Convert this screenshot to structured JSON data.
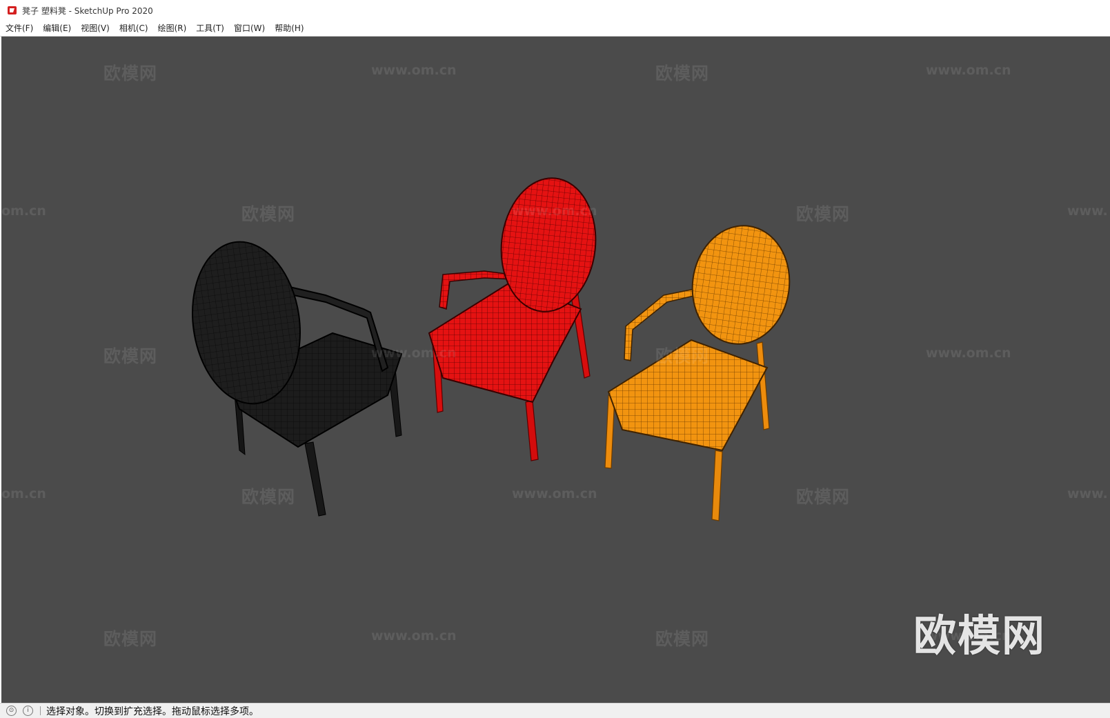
{
  "window": {
    "title": "凳子 塑料凳 - SketchUp Pro 2020",
    "app_icon": "sketchup-icon"
  },
  "menu": [
    {
      "label": "文件(F)"
    },
    {
      "label": "编辑(E)"
    },
    {
      "label": "视图(V)"
    },
    {
      "label": "相机(C)"
    },
    {
      "label": "绘图(R)"
    },
    {
      "label": "工具(T)"
    },
    {
      "label": "窗口(W)"
    },
    {
      "label": "帮助(H)"
    }
  ],
  "viewport": {
    "background": "#4b4b4b",
    "models": [
      {
        "name": "chair-black",
        "color": "#1c1c1c"
      },
      {
        "name": "chair-red",
        "color": "#e01010"
      },
      {
        "name": "chair-orange",
        "color": "#f0900e"
      }
    ],
    "watermark_brand": "欧模网",
    "watermark_url": "www.om.cn",
    "watermark_partial_url": "om.cn",
    "watermark_partial_url_right": "www.",
    "logo_text": "欧模网"
  },
  "status": {
    "icons": [
      "geo-location-icon",
      "info-icon"
    ],
    "message": "选择对象。切换到扩充选择。拖动鼠标选择多项。"
  }
}
